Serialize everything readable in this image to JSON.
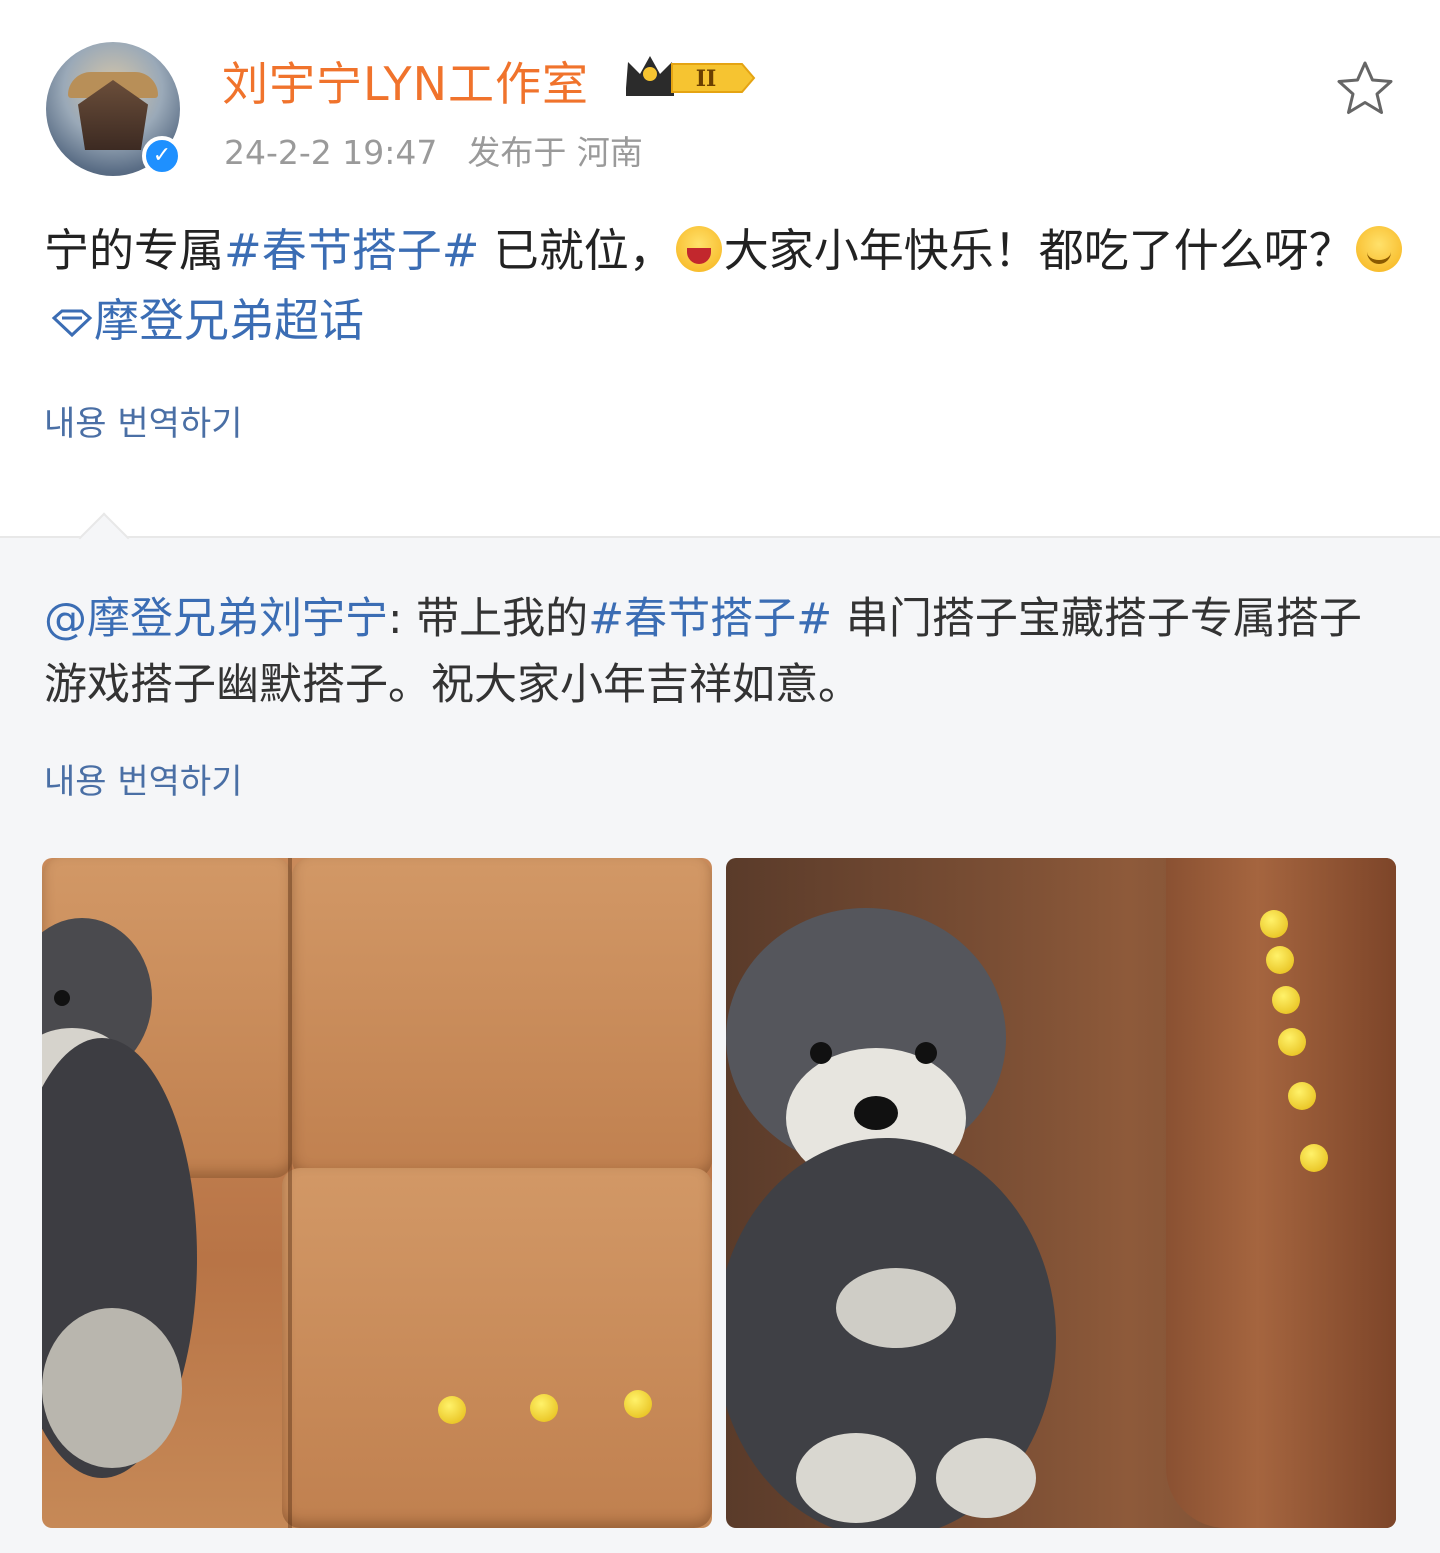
{
  "header": {
    "username": "刘宇宁LYN工作室",
    "badge_level": "II",
    "timestamp": "24-2-2 19:47",
    "location": "发布于 河南",
    "verified_icon": "verified-check-icon",
    "favorite_icon": "star-outline-icon"
  },
  "post": {
    "text_part1": "宁的专属",
    "hashtag1": "#春节搭子#",
    "text_part2": " 已就位，",
    "text_part3": "大家小年快乐！都吃了什么呀？",
    "supertopic": "摩登兄弟超话",
    "translate_label": "내용 번역하기"
  },
  "repost": {
    "mention": "@摩登兄弟刘宇宁",
    "text_part1": ": 带上我的",
    "hashtag": "#春节搭子#",
    "text_part2": " 串门搭子宝藏搭子专属搭子游戏搭子幽默搭子。祝大家小年吉祥如意。",
    "translate_label": "내용 번역하기"
  },
  "colors": {
    "username": "#f0732c",
    "link": "#3b6db4",
    "meta": "#9a9a9a",
    "repost_bg": "#f5f6f8"
  }
}
